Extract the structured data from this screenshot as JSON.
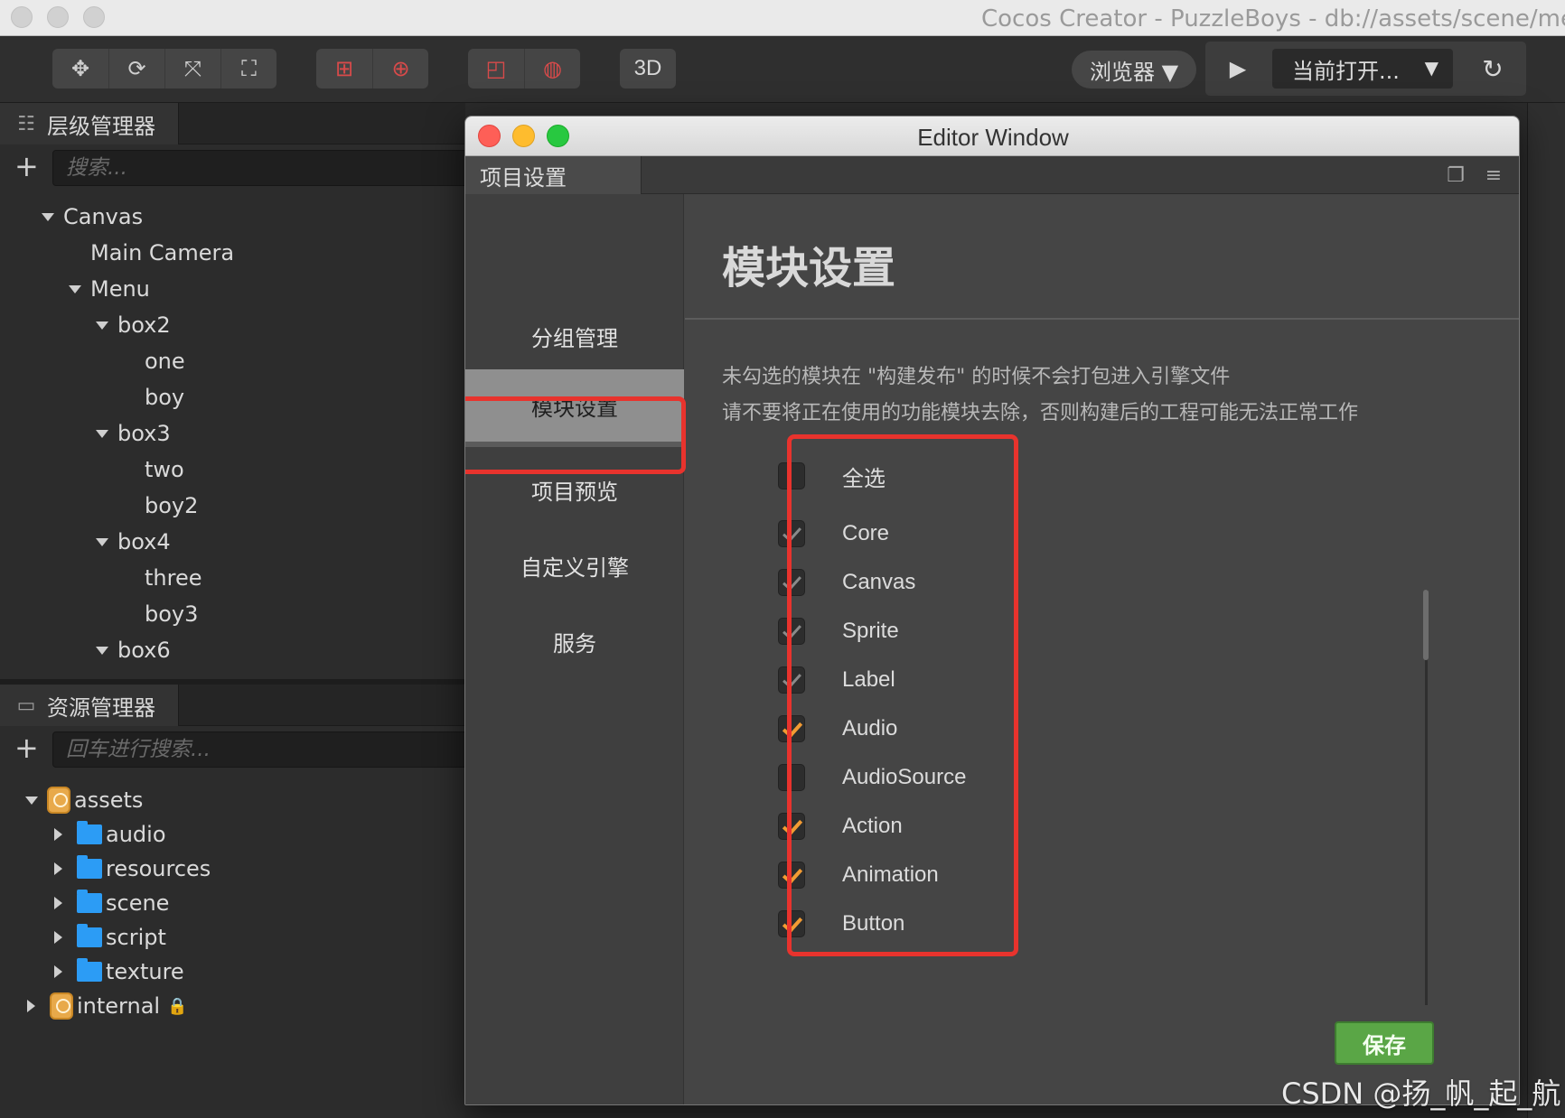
{
  "app": {
    "window_title": "Cocos Creator - PuzzleBoys - db://assets/scene/menu"
  },
  "toolbar": {
    "transform_tools": [
      "move-icon",
      "rotate-icon",
      "scale-icon",
      "rect-icon"
    ],
    "btn_3d": "3D",
    "browser_select": "浏览器 ▼",
    "current_scene_select": "当前打开...",
    "caret": "▼"
  },
  "hierarchy": {
    "tab_label": "层级管理器",
    "search_placeholder": "搜索...",
    "nodes": [
      {
        "label": "Canvas"
      },
      {
        "label": "Main Camera"
      },
      {
        "label": "Menu"
      },
      {
        "label": "box2"
      },
      {
        "label": "one"
      },
      {
        "label": "boy"
      },
      {
        "label": "box3"
      },
      {
        "label": "two"
      },
      {
        "label": "boy2"
      },
      {
        "label": "box4"
      },
      {
        "label": "three"
      },
      {
        "label": "boy3"
      },
      {
        "label": "box6"
      }
    ]
  },
  "assets": {
    "tab_label": "资源管理器",
    "search_placeholder": "回车进行搜索...",
    "items": [
      {
        "label": "assets"
      },
      {
        "label": "audio"
      },
      {
        "label": "resources"
      },
      {
        "label": "scene"
      },
      {
        "label": "script"
      },
      {
        "label": "texture"
      },
      {
        "label": "internal"
      }
    ]
  },
  "editor_window": {
    "title": "Editor Window",
    "tab_label": "项目设置",
    "nav": [
      {
        "label": "分组管理"
      },
      {
        "label": "模块设置"
      },
      {
        "label": "项目预览"
      },
      {
        "label": "自定义引擎"
      },
      {
        "label": "服务"
      }
    ],
    "content_title": "模块设置",
    "desc_line1": "未勾选的模块在 \"构建发布\" 的时候不会打包进入引擎文件",
    "desc_line2": "请不要将正在使用的功能模块去除，否则构建后的工程可能无法正常工作",
    "modules": [
      {
        "label": "全选",
        "state": "unchecked"
      },
      {
        "label": "Core",
        "state": "locked"
      },
      {
        "label": "Canvas",
        "state": "locked"
      },
      {
        "label": "Sprite",
        "state": "locked"
      },
      {
        "label": "Label",
        "state": "locked"
      },
      {
        "label": "Audio",
        "state": "checked"
      },
      {
        "label": "AudioSource",
        "state": "unchecked"
      },
      {
        "label": "Action",
        "state": "checked"
      },
      {
        "label": "Animation",
        "state": "checked"
      },
      {
        "label": "Button",
        "state": "checked"
      }
    ],
    "save_label": "保存"
  },
  "colors": {
    "accent_check": "#f29b33",
    "highlight_red": "#e8332d",
    "save_green": "#5aa646"
  },
  "watermark": "CSDN @扬_帆_起_航"
}
